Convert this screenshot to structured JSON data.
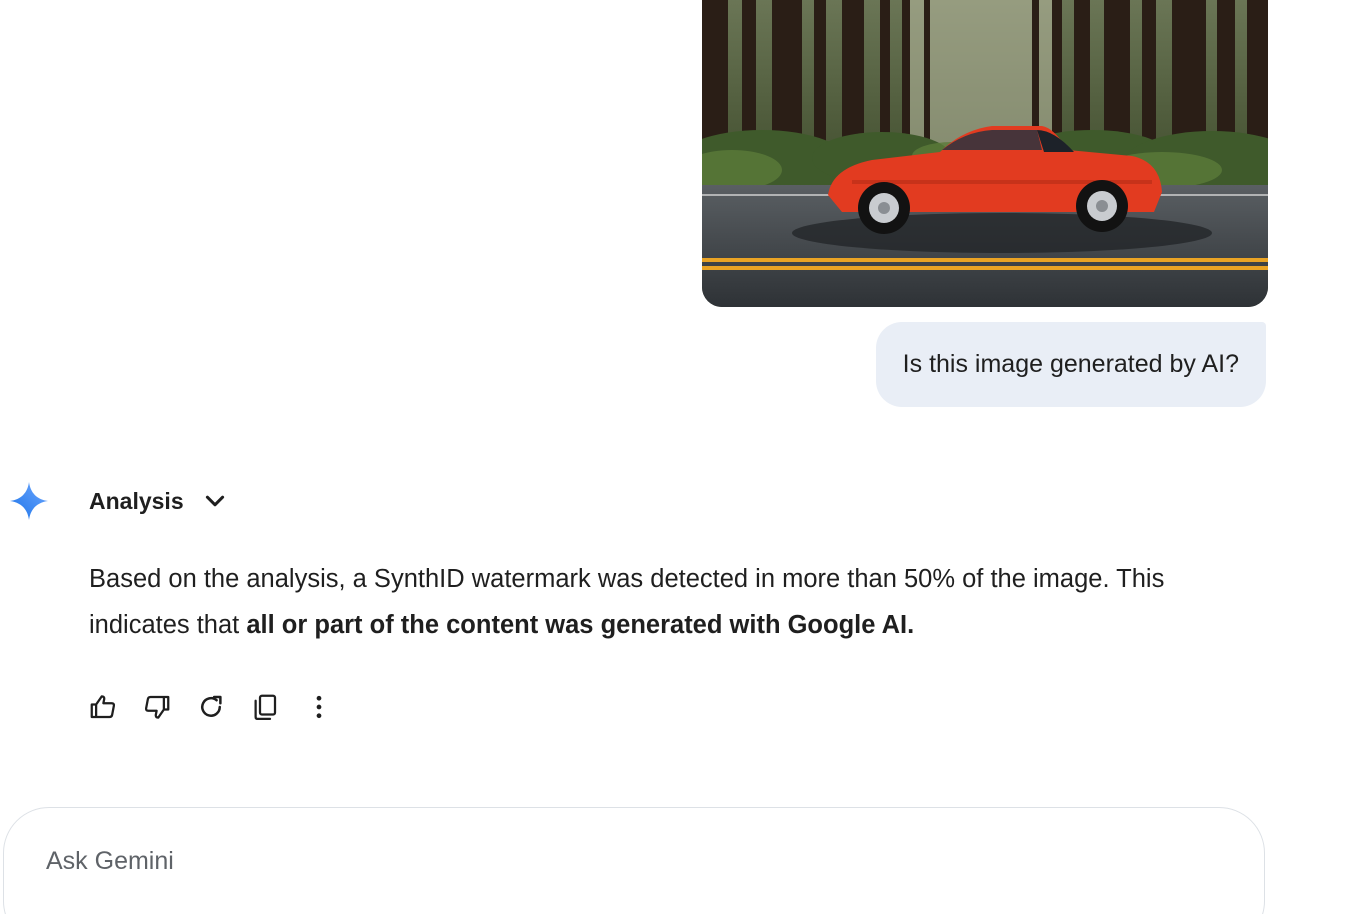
{
  "uploaded_image": {
    "description": "photo",
    "colors": {
      "car": "#e23b20",
      "road": "#3c4146",
      "stripe": "#e9a324",
      "forest": "#2e3b22"
    }
  },
  "user_message": {
    "text": "Is this image generated by AI?"
  },
  "response": {
    "icon": "gemini-sparkle-icon",
    "header_title": "Analysis",
    "header_toggle_icon": "chevron-down-icon",
    "text_plain": "Based on the analysis, a SynthID watermark was detected in more than 50% of the image. This indicates that ",
    "text_bold": "all or part of the content was generated with Google AI.",
    "actions": [
      {
        "name": "thumbs-up-icon"
      },
      {
        "name": "thumbs-down-icon"
      },
      {
        "name": "regenerate-icon"
      },
      {
        "name": "copy-icon"
      },
      {
        "name": "more-vert-icon"
      }
    ]
  },
  "input": {
    "placeholder": "Ask Gemini"
  },
  "colors": {
    "bubble_bg": "#e9eef6",
    "gemini_blue": "#4285f4",
    "text": "#1f1f1f"
  }
}
